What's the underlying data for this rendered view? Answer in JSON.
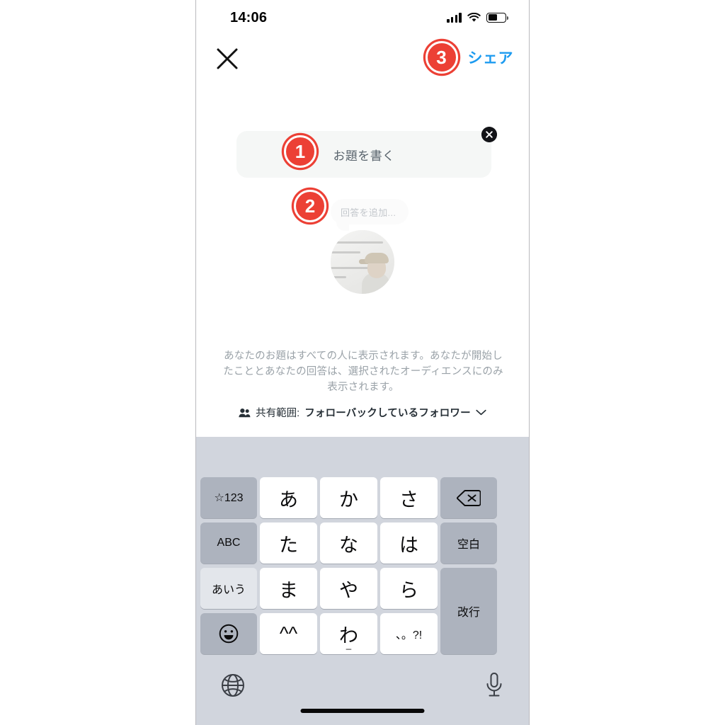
{
  "status_bar": {
    "time": "14:06",
    "signal_icon": "cellular-bars-icon",
    "wifi_icon": "wifi-icon",
    "battery_icon": "battery-icon",
    "battery_level": 50
  },
  "nav_bar": {
    "close_icon": "close-x-icon",
    "share_label": "シェア",
    "share_color": "#1d9bf0"
  },
  "annotations": {
    "accent_color": "#ec4035",
    "badge_1": "1",
    "badge_2": "2",
    "badge_3": "3"
  },
  "composer": {
    "prompt_placeholder": "お題を書く",
    "card_close_icon": "close-circle-icon",
    "answer_placeholder": "回答を追加...",
    "avatar_icon": "user-avatar-photo"
  },
  "description": "あなたのお題はすべての人に表示されます。あなたが開始したこととあなたの回答は、選択されたオーディエンスにのみ表示されます。",
  "audience": {
    "people_icon": "people-icon",
    "prefix": "共有範囲:",
    "value": "フォローバックしているフォロワー",
    "chevron_icon": "chevron-down-icon"
  },
  "keyboard": {
    "language": "japanese-kana",
    "rows": [
      [
        {
          "label": "☆123",
          "name": "key-symbols",
          "type": "func",
          "size": "small"
        },
        {
          "label": "あ",
          "name": "key-a",
          "type": "letter"
        },
        {
          "label": "か",
          "name": "key-ka",
          "type": "letter"
        },
        {
          "label": "さ",
          "name": "key-sa",
          "type": "letter"
        },
        {
          "label": "",
          "name": "key-delete",
          "type": "func",
          "icon": "delete-backward-icon"
        }
      ],
      [
        {
          "label": "ABC",
          "name": "key-abc",
          "type": "func",
          "size": "small"
        },
        {
          "label": "た",
          "name": "key-ta",
          "type": "letter"
        },
        {
          "label": "な",
          "name": "key-na",
          "type": "letter"
        },
        {
          "label": "は",
          "name": "key-ha",
          "type": "letter"
        },
        {
          "label": "空白",
          "name": "key-space",
          "type": "func",
          "size": "small"
        }
      ],
      [
        {
          "label": "あいう",
          "name": "key-kana-mode",
          "type": "func-light",
          "size": "small"
        },
        {
          "label": "ま",
          "name": "key-ma",
          "type": "letter"
        },
        {
          "label": "や",
          "name": "key-ya",
          "type": "letter"
        },
        {
          "label": "ら",
          "name": "key-ra",
          "type": "letter"
        },
        {
          "label": "改行",
          "name": "key-return",
          "type": "func",
          "size": "small"
        }
      ],
      [
        {
          "label": "",
          "name": "key-emoji",
          "type": "func",
          "icon": "smiley-icon"
        },
        {
          "label": "^^",
          "name": "key-kaomoji",
          "type": "letter"
        },
        {
          "label": "わ",
          "name": "key-wa",
          "type": "letter",
          "sub": "_"
        },
        {
          "label": "、。?!",
          "name": "key-punctuation",
          "type": "letter",
          "size": "small"
        }
      ]
    ],
    "bottom": {
      "globe_icon": "globe-icon",
      "mic_icon": "microphone-icon"
    }
  },
  "home_indicator": "home-indicator"
}
